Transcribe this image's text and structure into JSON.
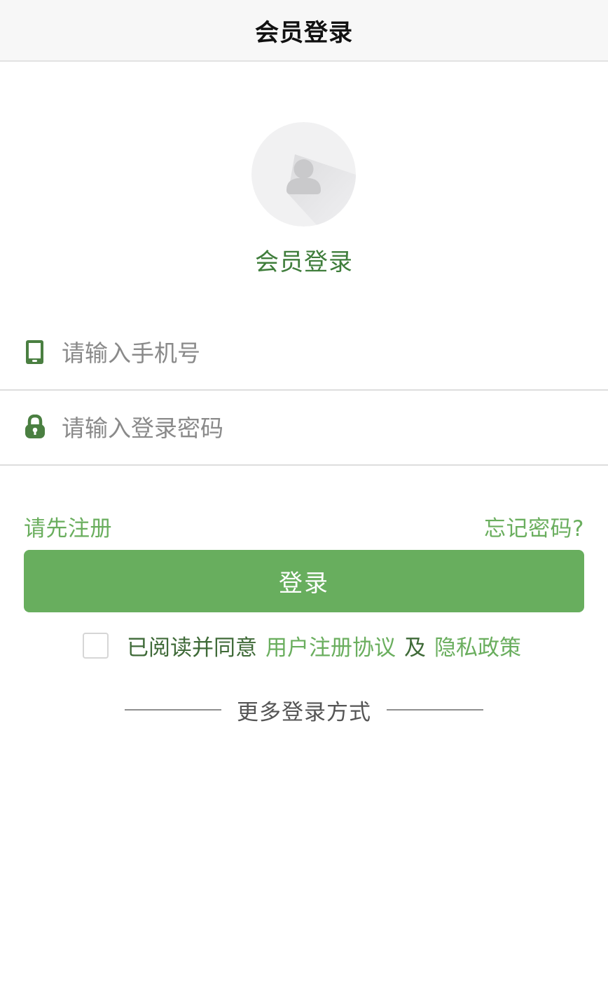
{
  "header": {
    "title": "会员登录"
  },
  "avatar": {
    "icon": "user-avatar-icon"
  },
  "sub_title": "会员登录",
  "form": {
    "phone": {
      "icon": "mobile-phone-icon",
      "placeholder": "请输入手机号",
      "value": ""
    },
    "password": {
      "icon": "lock-icon",
      "placeholder": "请输入登录密码",
      "value": ""
    }
  },
  "links": {
    "register": "请先注册",
    "forgot_password": "忘记密码?"
  },
  "login_button": "登录",
  "agreement": {
    "checked": false,
    "prefix": "已阅读并同意",
    "user_agreement": "用户注册协议",
    "and": "及",
    "privacy_policy": "隐私政策"
  },
  "more_login": "更多登录方式",
  "colors": {
    "accent": "#68ae5e",
    "title_green": "#3f7d3b",
    "header_bg": "#f7f7f7",
    "icon_green": "#4a7f41"
  }
}
